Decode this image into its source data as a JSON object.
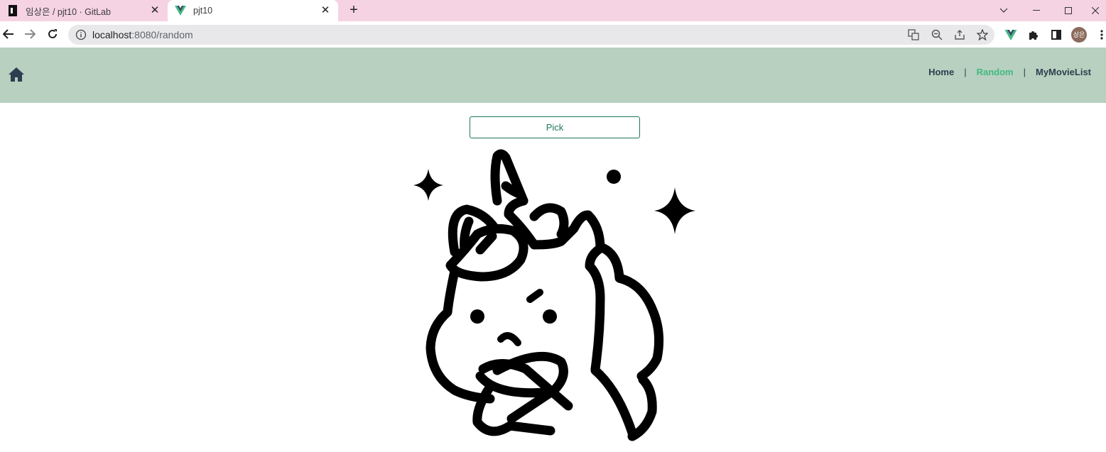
{
  "browser": {
    "tabs": [
      {
        "title": "임상은 / pjt10 · GitLab",
        "active": false,
        "icon": "gitlab-icon"
      },
      {
        "title": "pjt10",
        "active": true,
        "icon": "vue-icon"
      }
    ],
    "address": {
      "host": "localhost",
      "rest": ":8080/random"
    },
    "profile_initials": "상은"
  },
  "navbar": {
    "home_icon": "home-icon",
    "links": [
      {
        "label": "Home",
        "active": false
      },
      {
        "label": "Random",
        "active": true
      },
      {
        "label": "MyMovieList",
        "active": false
      }
    ],
    "separator": "|"
  },
  "main": {
    "pick_label": "Pick",
    "illustration": "sad-unicorn-illustration"
  },
  "colors": {
    "tab_strip": "#f5d3e3",
    "navbar_bg": "#b7d0bf",
    "nav_text": "#2c3e50",
    "nav_active": "#42b983",
    "button_border": "#1e7a55"
  }
}
